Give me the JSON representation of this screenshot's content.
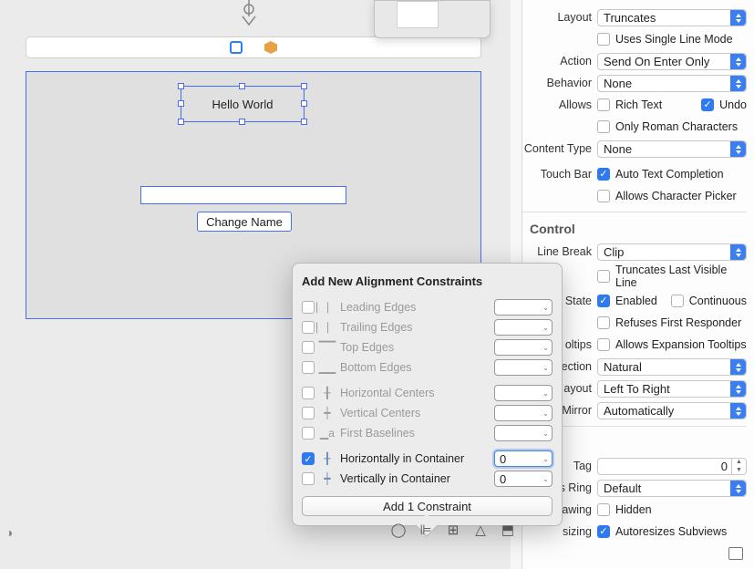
{
  "canvas": {
    "label_text": "Hello World",
    "button_label": "Change Name"
  },
  "inspector": {
    "layout": {
      "label": "Layout",
      "value": "Truncates"
    },
    "uses_single_line": "Uses Single Line Mode",
    "action": {
      "label": "Action",
      "value": "Send On Enter Only"
    },
    "behavior": {
      "label": "Behavior",
      "value": "None"
    },
    "allows": {
      "label": "Allows",
      "rich_text": "Rich Text",
      "undo": "Undo",
      "only_roman": "Only Roman Characters"
    },
    "content_type": {
      "label": "Content Type",
      "value": "None"
    },
    "touch_bar": {
      "label": "Touch Bar",
      "auto_complete": "Auto Text Completion",
      "char_picker": "Allows Character Picker"
    },
    "control_header": "Control",
    "line_break": {
      "label": "Line Break",
      "value": "Clip"
    },
    "truncates_last": "Truncates Last Visible Line",
    "state": {
      "label": "State",
      "enabled": "Enabled",
      "continuous": "Continuous",
      "refuses": "Refuses First Responder"
    },
    "tooltips": {
      "label": "oltips",
      "allows": "Allows Expansion Tooltips"
    },
    "direction": {
      "label": "ection",
      "value": "Natural"
    },
    "ilayout": {
      "label": "ayout",
      "value": "Left To Right"
    },
    "mirror": {
      "label": "Mirror",
      "value": "Automatically"
    },
    "tag": {
      "label": "Tag",
      "value": "0"
    },
    "focus_ring": {
      "label": "s Ring",
      "value": "Default"
    },
    "drawing": {
      "label": "awing",
      "hidden": "Hidden"
    },
    "sizing": {
      "label": "sizing",
      "auto": "Autoresizes Subviews"
    }
  },
  "popover": {
    "title": "Add New Alignment Constraints",
    "leading": "Leading Edges",
    "trailing": "Trailing Edges",
    "top": "Top Edges",
    "bottom": "Bottom Edges",
    "hcenters": "Horizontal Centers",
    "vcenters": "Vertical Centers",
    "baselines": "First Baselines",
    "hcontainer": "Horizontally in Container",
    "vcontainer": "Vertically in Container",
    "hval": "0",
    "vval": "0",
    "add_btn": "Add 1 Constraint"
  }
}
